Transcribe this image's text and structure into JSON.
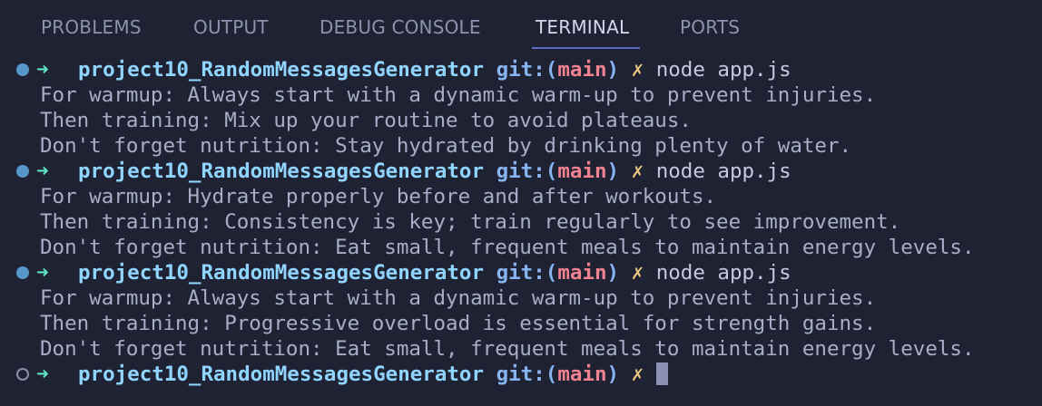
{
  "tabs": [
    {
      "label": "PROBLEMS"
    },
    {
      "label": "OUTPUT"
    },
    {
      "label": "DEBUG CONSOLE"
    },
    {
      "label": "TERMINAL"
    },
    {
      "label": "PORTS"
    }
  ],
  "active_tab": "TERMINAL",
  "prompt": {
    "arrow": "➜",
    "dir": "project10_RandomMessagesGenerator",
    "git_open": "git:(",
    "branch": "main",
    "git_close": ")",
    "dirty_mark": "✗"
  },
  "runs": [
    {
      "command": "node app.js",
      "output": [
        "For warmup: Always start with a dynamic warm-up to prevent injuries.",
        "Then training: Mix up your routine to avoid plateaus.",
        "Don't forget nutrition: Stay hydrated by drinking plenty of water."
      ]
    },
    {
      "command": "node app.js",
      "output": [
        "For warmup: Hydrate properly before and after workouts.",
        "Then training: Consistency is key; train regularly to see improvement.",
        "Don't forget nutrition: Eat small, frequent meals to maintain energy levels."
      ]
    },
    {
      "command": "node app.js",
      "output": [
        "For warmup: Always start with a dynamic warm-up to prevent injuries.",
        "Then training: Progressive overload is essential for strength gains.",
        "Don't forget nutrition: Eat small, frequent meals to maintain energy levels."
      ]
    }
  ],
  "colors": {
    "background": "#1f2233",
    "accent_underline": "#5a6bc4",
    "directory": "#8fd5ff",
    "branch": "#f0828f",
    "arrow": "#5fe3c8",
    "dirty_mark": "#e8c37a"
  }
}
